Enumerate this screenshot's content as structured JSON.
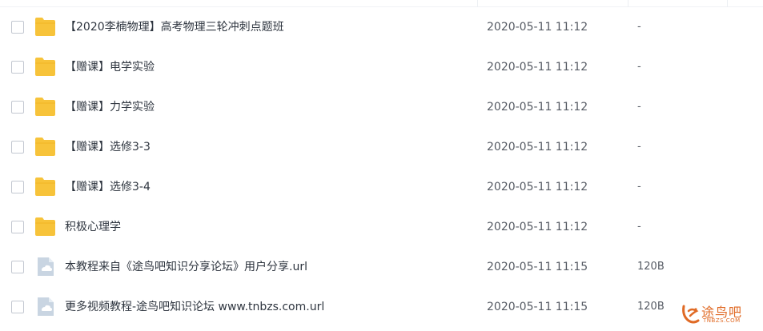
{
  "files": [
    {
      "type": "folder",
      "icon": "folder-icon",
      "name": "【2020李楠物理】高考物理三轮冲刺点题班",
      "modified": "2020-05-11 11:12",
      "size": "-"
    },
    {
      "type": "folder",
      "icon": "folder-icon",
      "name": "【赠课】电学实验",
      "modified": "2020-05-11 11:12",
      "size": "-"
    },
    {
      "type": "folder",
      "icon": "folder-icon",
      "name": "【赠课】力学实验",
      "modified": "2020-05-11 11:12",
      "size": "-"
    },
    {
      "type": "folder",
      "icon": "folder-icon",
      "name": "【赠课】选修3-3",
      "modified": "2020-05-11 11:12",
      "size": "-"
    },
    {
      "type": "folder",
      "icon": "folder-icon",
      "name": "【赠课】选修3-4",
      "modified": "2020-05-11 11:12",
      "size": "-"
    },
    {
      "type": "folder",
      "icon": "folder-icon",
      "name": "积极心理学",
      "modified": "2020-05-11 11:12",
      "size": "-"
    },
    {
      "type": "file",
      "icon": "url-file-icon",
      "name": "本教程来自《途鸟吧知识分享论坛》用户分享.url",
      "modified": "2020-05-11 11:15",
      "size": "120B"
    },
    {
      "type": "file",
      "icon": "url-file-icon",
      "name": "更多视频教程-途鸟吧知识论坛 www.tnbzs.com.url",
      "modified": "2020-05-11 11:15",
      "size": "120B"
    }
  ],
  "watermark": {
    "text": "途鸟吧",
    "sub": "TNBZS.COM",
    "color": "#e06a25"
  },
  "colors": {
    "folder": "#f7c33a",
    "file": "#b7c6d6"
  }
}
